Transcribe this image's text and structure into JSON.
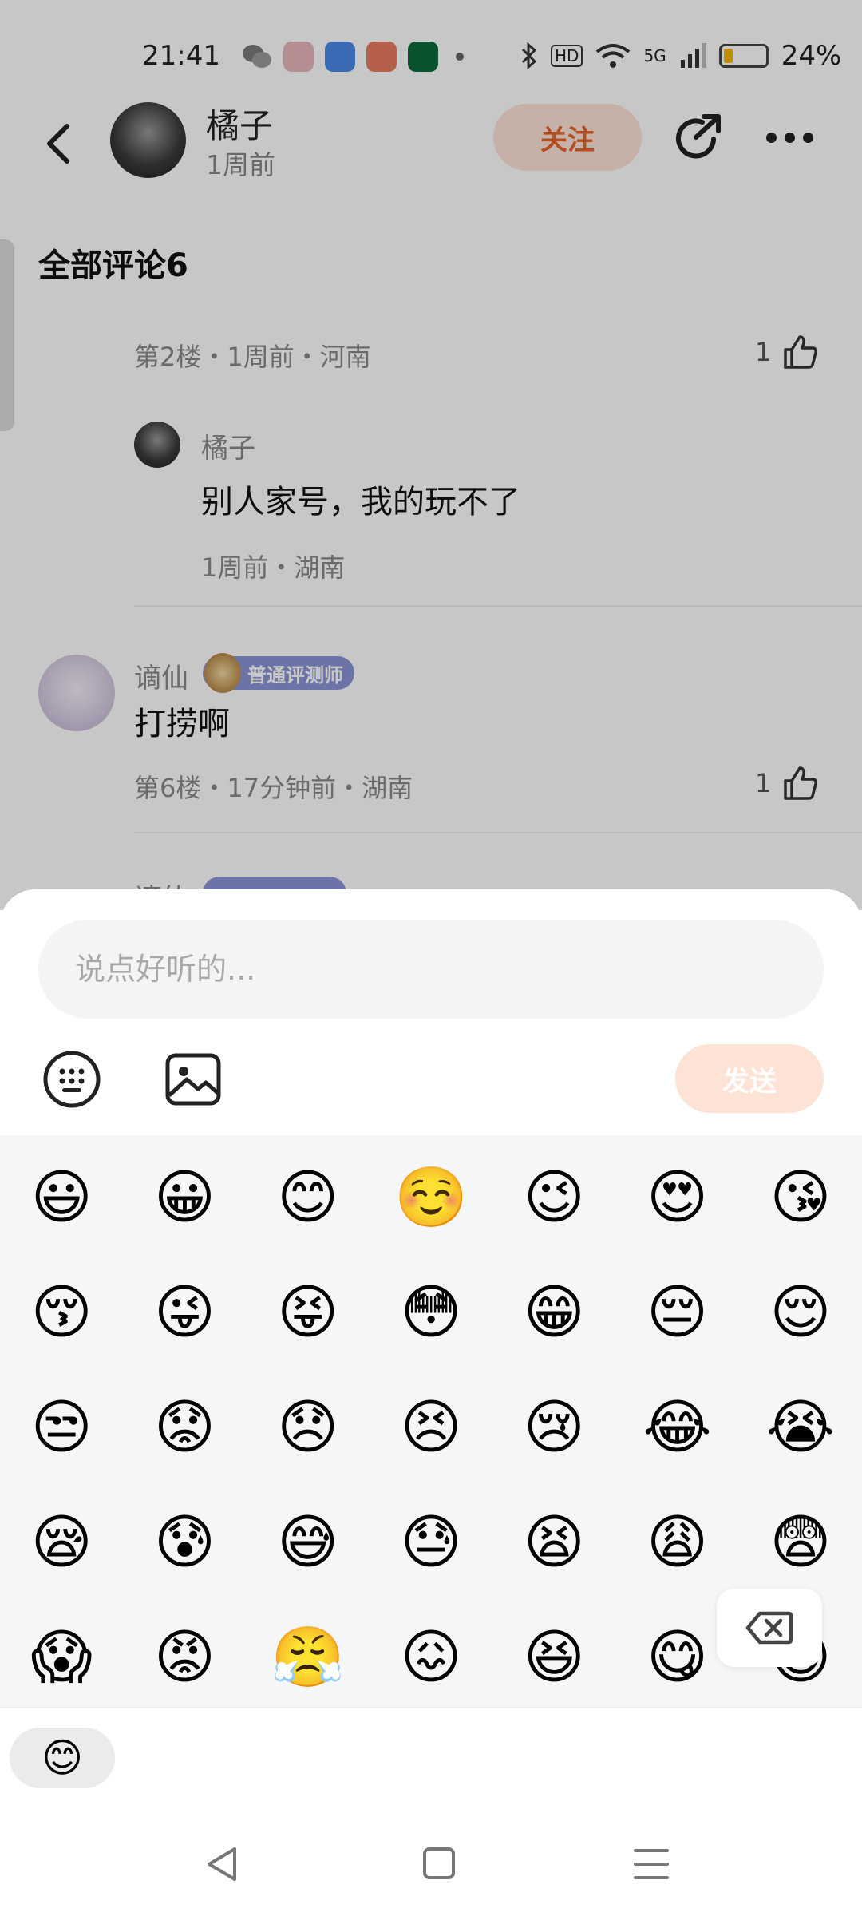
{
  "status_bar": {
    "time": "21:41",
    "network": "5G",
    "hd": "HD",
    "battery_percent": "24%",
    "battery_level": 0.24,
    "app_icon_colors": [
      "#e8b7bb",
      "#7b7b7b",
      "#4e8ae8",
      "#e87b60",
      "#0b6b3c"
    ]
  },
  "header": {
    "author_name": "橘子",
    "author_time": "1周前",
    "follow_label": "关注"
  },
  "comments": {
    "section_title": "全部评论6",
    "first": {
      "meta": "第2楼・1周前・河南",
      "likes": "1",
      "reply": {
        "name": "橘子",
        "text": "别人家号，我的玩不了",
        "meta": "1周前・湖南"
      }
    },
    "second": {
      "name": "谪仙",
      "badge": "普通评测师",
      "text": "打捞啊",
      "meta": "第6楼・17分钟前・湖南",
      "likes": "1"
    },
    "peek_name": "谪仙"
  },
  "composer": {
    "placeholder": "说点好听的...",
    "value": "",
    "send_label": "发送",
    "keyboard_icon": "keyboard-icon",
    "image_icon": "image-icon"
  },
  "emojis": [
    "😃",
    "😀",
    "😊",
    "☺️",
    "😉",
    "😍",
    "😘",
    "😚",
    "😜",
    "😝",
    "😳",
    "😁",
    "😔",
    "😌",
    "😒",
    "😟",
    "😞",
    "😣",
    "😢",
    "😂",
    "😭",
    "😪",
    "😰",
    "😅",
    "😓",
    "😫",
    "😩",
    "😨",
    "😱",
    "😡",
    "😤",
    "😖",
    "😆",
    "😋",
    "😄"
  ],
  "emoji_tab": "😊",
  "nav": {
    "back_icon": "nav-back-icon",
    "home_icon": "nav-home-icon",
    "menu_icon": "nav-menu-icon"
  },
  "colors": {
    "accent": "#e5642c",
    "accent_light": "#fde3d6",
    "badge": "#8b95d6"
  }
}
